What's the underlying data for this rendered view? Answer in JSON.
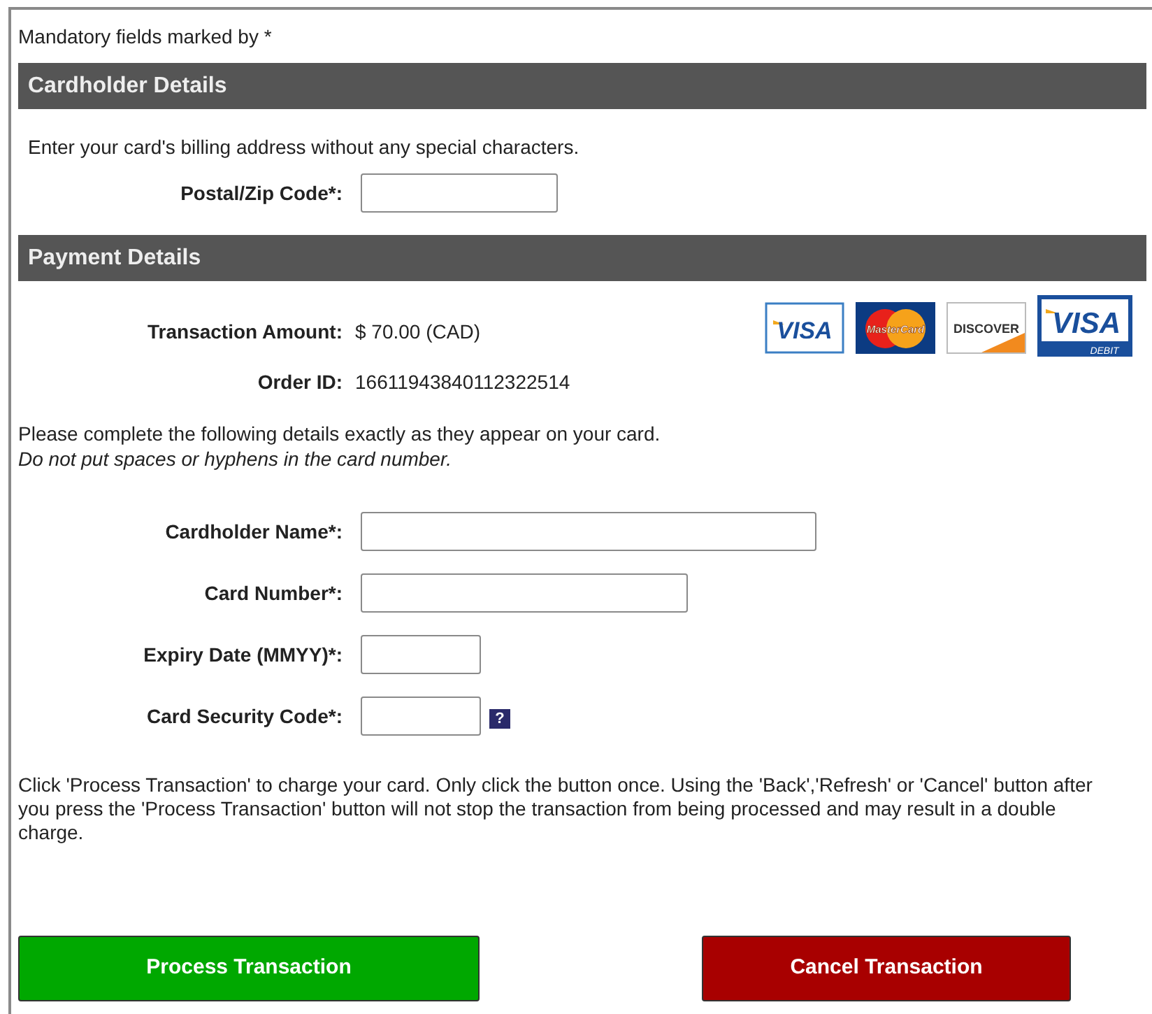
{
  "mandatory_note": "Mandatory fields marked by *",
  "cardholder_section": {
    "title": "Cardholder Details",
    "instruction": "Enter your card's billing address without any special characters.",
    "fields": [
      {
        "label": "Postal/Zip Code*:",
        "kind": "medium"
      }
    ]
  },
  "payment_section": {
    "title": "Payment Details",
    "summary": [
      {
        "label": "Transaction Amount:",
        "value": "$ 70.00 (CAD)"
      },
      {
        "label": "Order ID:",
        "value": "16611943840112322514"
      }
    ],
    "cards": [
      {
        "kind": "visa",
        "text": "VISA"
      },
      {
        "kind": "mastercard",
        "text": "MasterCard"
      },
      {
        "kind": "discover",
        "text": "DISCOVER"
      },
      {
        "kind": "visadebit",
        "text": "VISA",
        "subtext": "DEBIT"
      }
    ],
    "instruction": "Please complete the following details exactly as they appear on your card.",
    "instruction_note": "Do not put spaces or hyphens in the card number.",
    "fields": [
      {
        "label": "Cardholder Name*:",
        "kind": "wide"
      },
      {
        "label": "Card Number*:",
        "kind": "large"
      },
      {
        "label": "Expiry Date (MMYY)*:",
        "kind": "small"
      },
      {
        "label": "Card Security Code*:",
        "kind": "small",
        "help": "?"
      }
    ]
  },
  "notice": "Click 'Process Transaction' to charge your card. Only click the button once. Using the 'Back','Refresh' or 'Cancel' button after you press the 'Process Transaction' button will not stop the transaction from being processed and may result in a double charge.",
  "buttons": [
    {
      "kind": "process",
      "label": "Process Transaction"
    },
    {
      "kind": "cancel",
      "label": "Cancel Transaction"
    }
  ]
}
